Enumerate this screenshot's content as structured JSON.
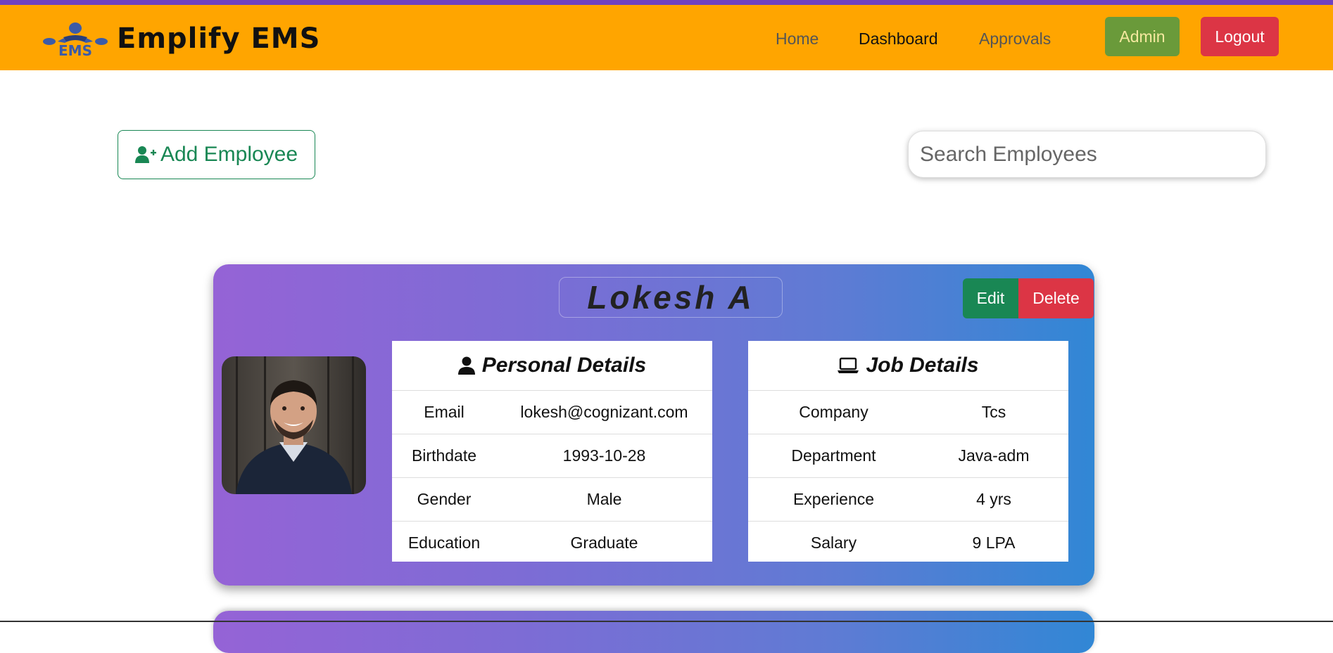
{
  "brand": {
    "name": "Emplify EMS",
    "logo_text": "EMS"
  },
  "nav": {
    "home": "Home",
    "dashboard": "Dashboard",
    "approvals": "Approvals",
    "admin": "Admin",
    "logout": "Logout"
  },
  "toolbar": {
    "add_label": "Add Employee",
    "search_placeholder": "Search Employees"
  },
  "employee": {
    "name": "Lokesh A",
    "edit_label": "Edit",
    "delete_label": "Delete",
    "personal": {
      "title": "Personal Details",
      "rows": [
        {
          "label": "Email",
          "value": "lokesh@cognizant.com"
        },
        {
          "label": "Birthdate",
          "value": "1993-10-28"
        },
        {
          "label": "Gender",
          "value": "Male"
        },
        {
          "label": "Education",
          "value": "Graduate"
        }
      ]
    },
    "job": {
      "title": "Job Details",
      "rows": [
        {
          "label": "Company",
          "value": "Tcs"
        },
        {
          "label": "Department",
          "value": "Java-adm"
        },
        {
          "label": "Experience",
          "value": "4 yrs"
        },
        {
          "label": "Salary",
          "value": "9 LPA"
        }
      ]
    }
  },
  "colors": {
    "navbar": "#ffa500",
    "accent_green": "#198754",
    "danger_red": "#dc3545",
    "admin_green": "#6a9a3a",
    "card_gradient_start": "#9563d6",
    "card_gradient_end": "#3187d5"
  },
  "icons": {
    "logo": "ems-people-logo-icon",
    "add": "user-plus-icon",
    "personal": "user-icon",
    "job": "laptop-icon"
  }
}
